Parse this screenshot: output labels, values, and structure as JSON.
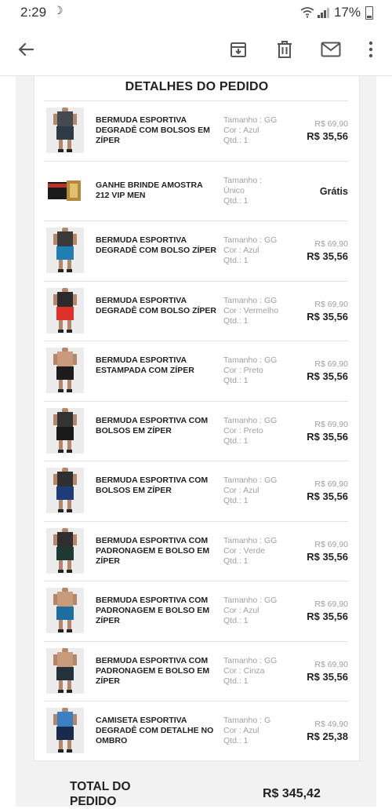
{
  "status_bar": {
    "time": "2:29",
    "battery": "17%"
  },
  "app_bar": {
    "icons": [
      "back-arrow-icon",
      "archive-icon",
      "trash-icon",
      "mail-icon",
      "more-vert-icon"
    ]
  },
  "order": {
    "title": "DETALHES DO PEDIDO",
    "items": [
      {
        "name": "BERMUDA ESPORTIVA DEGRADÊ COM BOLSOS EM ZÍPER",
        "size": "Tamanho : GG",
        "color": "Cor : Azul",
        "qty": "Qtd.: 1",
        "old_price": "R$ 69,90",
        "price": "R$ 35,56",
        "short_color": "#2e3a46",
        "shirt_color": "#444a52"
      },
      {
        "name": "GANHE BRINDE AMOSTRA 212 VIP MEN",
        "size": "Tamanho : Único",
        "color": "",
        "qty": "Qtd.: 1",
        "old_price": "",
        "price": "Grátis",
        "short_color": "#c8a040",
        "shirt_color": "#1a1a1a"
      },
      {
        "name": "BERMUDA ESPORTIVA DEGRADÊ COM BOLSO ZÍPER",
        "size": "Tamanho : GG",
        "color": "Cor : Azul",
        "qty": "Qtd.: 1",
        "old_price": "R$ 69,90",
        "price": "R$ 35,56",
        "short_color": "#1f7fb3",
        "shirt_color": "#3a3a3a"
      },
      {
        "name": "BERMUDA ESPORTIVA DEGRADÊ COM BOLSO ZÍPER",
        "size": "Tamanho : GG",
        "color": "Cor : Vermelho",
        "qty": "Qtd.: 1",
        "old_price": "R$ 69,90",
        "price": "R$ 35,56",
        "short_color": "#e0302a",
        "shirt_color": "#2b2b2b"
      },
      {
        "name": "BERMUDA ESPORTIVA ESTAMPADA COM ZÍPER",
        "size": "Tamanho : GG",
        "color": "Cor : Preto",
        "qty": "Qtd.: 1",
        "old_price": "R$ 69,90",
        "price": "R$ 35,56",
        "short_color": "#1c1c1c",
        "shirt_color": "#c99b7c"
      },
      {
        "name": "BERMUDA ESPORTIVA COM BOLSOS EM ZÍPER",
        "size": "Tamanho : GG",
        "color": "Cor : Preto",
        "qty": "Qtd.: 1",
        "old_price": "R$ 69,90",
        "price": "R$ 35,56",
        "short_color": "#1a1a1a",
        "shirt_color": "#333333"
      },
      {
        "name": "BERMUDA ESPORTIVA COM BOLSOS EM ZÍPER",
        "size": "Tamanho : GG",
        "color": "Cor : Azul",
        "qty": "Qtd.: 1",
        "old_price": "R$ 69,90",
        "price": "R$ 35,56",
        "short_color": "#1d3c78",
        "shirt_color": "#2f2f2f"
      },
      {
        "name": "BERMUDA ESPORTIVA COM PADRONAGEM E BOLSO EM ZÍPER",
        "size": "Tamanho : GG",
        "color": "Cor : Verde",
        "qty": "Qtd.: 1",
        "old_price": "R$ 69,90",
        "price": "R$ 35,56",
        "short_color": "#1f3a33",
        "shirt_color": "#2f2f2f"
      },
      {
        "name": "BERMUDA ESPORTIVA COM PADRONAGEM E BOLSO EM ZÍPER",
        "size": "Tamanho : GG",
        "color": "Cor : Azul",
        "qty": "Qtd.: 1",
        "old_price": "R$ 69,90",
        "price": "R$ 35,56",
        "short_color": "#1c6e9e",
        "shirt_color": "#c99b7c"
      },
      {
        "name": "BERMUDA ESPORTIVA COM PADRONAGEM E BOLSO EM ZÍPER",
        "size": "Tamanho : GG",
        "color": "Cor : Cinza",
        "qty": "Qtd.: 1",
        "old_price": "R$ 69,90",
        "price": "R$ 35,56",
        "short_color": "#23323a",
        "shirt_color": "#c99b7c"
      },
      {
        "name": "CAMISETA ESPORTIVA DEGRADÊ COM DETALHE NO OMBRO",
        "size": "Tamanho : G",
        "color": "Cor : Azul",
        "qty": "Qtd.: 1",
        "old_price": "R$ 49,90",
        "price": "R$ 25,38",
        "short_color": "#1a2a4a",
        "shirt_color": "#3b7fc4"
      }
    ],
    "total_label": "TOTAL DO PEDIDO",
    "total_value": "R$ 345,42"
  }
}
